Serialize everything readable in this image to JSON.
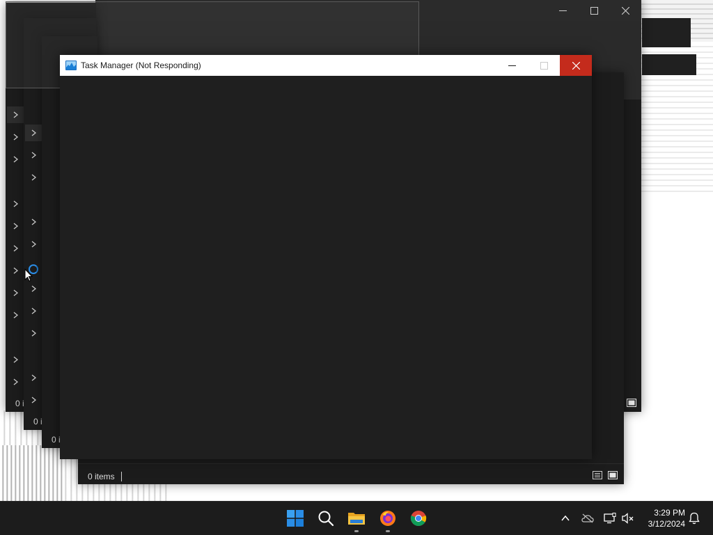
{
  "task_manager": {
    "title": "Task Manager (Not Responding)",
    "icon": "task-manager-icon"
  },
  "explorer_windows": {
    "status_items": "0 items",
    "status_fragment": "0 i"
  },
  "taskbar": {
    "items": [
      "start-icon",
      "search-icon",
      "file-explorer-icon",
      "firefox-icon",
      "chrome-icon"
    ],
    "tray": [
      "chevron-up-icon",
      "onedrive-icon",
      "network-icon",
      "volume-muted-icon"
    ],
    "time": "3:29 PM",
    "date": "3/12/2024",
    "notifications_icon": "bell-icon"
  },
  "colors": {
    "close_red": "#c42b1c",
    "window_dark": "#1c1c1c",
    "taskbar": "#1c1c1c",
    "accent_blue": "#2b8ee8"
  }
}
